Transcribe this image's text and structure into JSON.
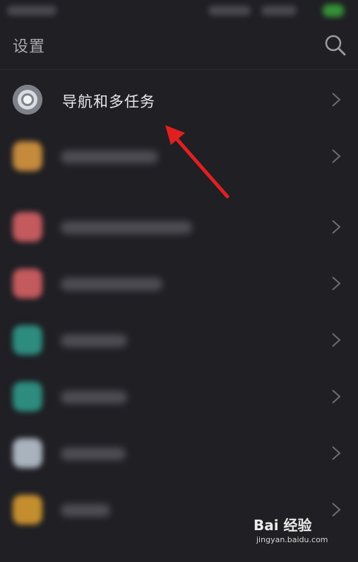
{
  "header": {
    "title": "设置",
    "search_icon": "search-icon"
  },
  "list": {
    "items": [
      {
        "label": "导航和多任务",
        "icon": "navigation-icon",
        "icon_color": "#cfd3d8",
        "blurred": false
      },
      {
        "label": "",
        "icon": "blurred-icon",
        "icon_color": "#c58a3c",
        "blurred": true
      },
      {
        "label": "",
        "icon": "blurred-icon",
        "icon_color": "#c35a5e",
        "blurred": true
      },
      {
        "label": "",
        "icon": "blurred-icon",
        "icon_color": "#c35a5e",
        "blurred": true
      },
      {
        "label": "",
        "icon": "blurred-icon",
        "icon_color": "#2d8c7e",
        "blurred": true
      },
      {
        "label": "",
        "icon": "blurred-icon",
        "icon_color": "#2d8c7e",
        "blurred": true
      },
      {
        "label": "",
        "icon": "blurred-icon",
        "icon_color": "#a9b3bd",
        "blurred": true
      },
      {
        "label": "",
        "icon": "blurred-icon",
        "icon_color": "#c48e2f",
        "blurred": true
      }
    ]
  },
  "annotation": {
    "color": "#e02020"
  },
  "watermark": {
    "brand": "Bai 经验",
    "sub": "jingyan.baidu.com"
  }
}
